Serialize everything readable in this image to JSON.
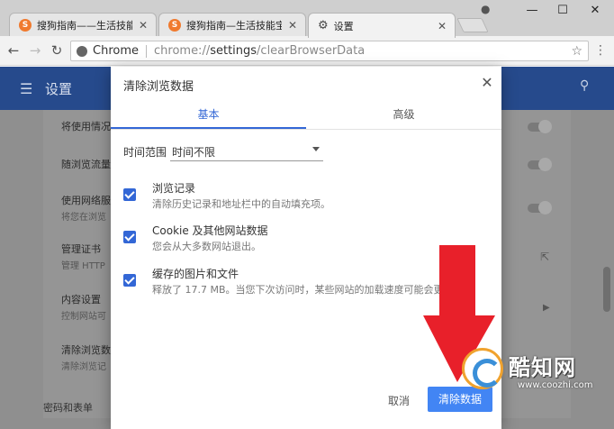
{
  "browser": {
    "tabs": [
      {
        "title": "搜狗指南——生活技能宝",
        "favicon": "S"
      },
      {
        "title": "搜狗指南—生活技能宝典",
        "favicon": "S"
      },
      {
        "title": "设置",
        "favicon": "gear-icon"
      }
    ],
    "window_controls": {
      "minimize": "—",
      "maximize": "☐",
      "close": "✕"
    },
    "address": {
      "chip": "Chrome",
      "url_scheme": "chrome://",
      "url_host": "settings",
      "url_path": "/clearBrowserData"
    }
  },
  "settings": {
    "title": "设置",
    "rows": [
      {
        "label": "将使用情况",
        "sub": ""
      },
      {
        "label": "随浏览流量",
        "sub": ""
      },
      {
        "label": "使用网络服",
        "sub": "将您在浏览"
      },
      {
        "label": "管理证书",
        "sub": "管理 HTTP"
      },
      {
        "label": "内容设置",
        "sub": "控制网站可"
      },
      {
        "label": "清除浏览数",
        "sub": "清除浏览记"
      }
    ],
    "bottom_label": "密码和表单"
  },
  "dialog": {
    "title": "清除浏览数据",
    "tabs": {
      "basic": "基本",
      "advanced": "高级"
    },
    "time_range": {
      "label": "时间范围",
      "value": "时间不限"
    },
    "options": [
      {
        "title": "浏览记录",
        "desc": "清除历史记录和地址栏中的自动填充项。",
        "checked": true
      },
      {
        "title": "Cookie 及其他网站数据",
        "desc": "您会从大多数网站退出。",
        "checked": true
      },
      {
        "title": "缓存的图片和文件",
        "desc": "释放了 17.7 MB。当您下次访问时，某些网站的加载速度可能会更",
        "checked": true
      }
    ],
    "cancel_label": "取消",
    "clear_label": "清除数据"
  },
  "watermark": {
    "name": "酷知网",
    "url": "www.coozhi.com"
  },
  "colors": {
    "accent": "#3367d6",
    "clear_button": "#4285f4",
    "arrow": "#e8202a",
    "header": "#264a8c"
  }
}
